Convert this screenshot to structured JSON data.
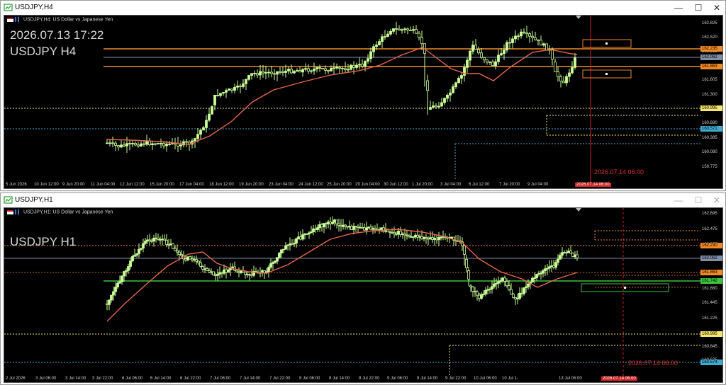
{
  "windows": [
    {
      "title": "USDJPY,H4",
      "header": "USDJPY,H4: US Dollar vs Japanese Yen",
      "big_lines": [
        "2026.07.13 17:22",
        "USDJPY H4"
      ],
      "price_scale": [
        "162.825",
        "162.520",
        "162.215",
        "161.605",
        "161.300",
        "160.995",
        "160.690",
        "160.385",
        "160.080",
        "159.775"
      ],
      "price_tags": [
        {
          "text": "162.235",
          "bg": "#f08a24",
          "fg": "#000000"
        },
        {
          "text": "162.062",
          "bg": "#7f8fa6",
          "fg": "#000000"
        },
        {
          "text": "161.863",
          "bg": "#f08a24",
          "fg": "#000000"
        },
        {
          "text": "160.995",
          "bg": "#f6e66a",
          "fg": "#000000"
        },
        {
          "text": "160.571",
          "bg": "#3fa9cf",
          "fg": "#000000"
        }
      ],
      "time_axis": [
        "5 Jun 2026",
        "10 Jun 12:00",
        "9 Jun 20:00",
        "11 Jun 04:00",
        "12 Jun 12:00",
        "15 Jun 20:00",
        "17 Jun 04:00",
        "18 Jun 12:00",
        "19 Jun 20:00",
        "23 Jun 04:00",
        "24 Jun 12:00",
        "25 Jun 20:00",
        "29 Jun 04:00",
        "30 Jun 12:00",
        "1 Jul 20:00",
        "3 Jul 04:00",
        "6 Jul 12:00",
        "7 Jul 20:00",
        "9 Jul 04:00"
      ],
      "time_now": "2026.07.14 06:00",
      "vline_label": "2026.07.14 06:00"
    },
    {
      "title": "USDJPY,H1",
      "header": "USDJPY,H1: US Dollar vs Japanese Yen",
      "big_lines": [
        "USDJPY H1"
      ],
      "price_scale": [
        "162.695",
        "162.475",
        "162.255",
        "161.660",
        "161.445",
        "161.225",
        "160.845",
        "160.635"
      ],
      "price_tags": [
        {
          "text": "162.230",
          "bg": "#f08a24",
          "fg": "#000000"
        },
        {
          "text": "162.062",
          "bg": "#7f8fa6",
          "fg": "#000000"
        },
        {
          "text": "161.863",
          "bg": "#f08a24",
          "fg": "#000000"
        },
        {
          "text": "161.742",
          "bg": "#3cc23c",
          "fg": "#000000"
        },
        {
          "text": "160.995",
          "bg": "#f6e66a",
          "fg": "#000000"
        },
        {
          "text": "160.574",
          "bg": "#3fa9cf",
          "fg": "#000000"
        }
      ],
      "time_axis": [
        "2 Jul 2026",
        "3 Jul 06:00",
        "3 Jul 14:00",
        "3 Jul 22:00",
        "6 Jul 06:00",
        "6 Jul 14:00",
        "6 Jul 22:00",
        "7 Jul 06:00",
        "7 Jul 14:00",
        "7 Jul 22:00",
        "8 Jul 06:00",
        "8 Jul 14:00",
        "8 Jul 22:00",
        "9 Jul 06:00",
        "9 Jul 14:00",
        "9 Jul 22:00",
        "10 Jul 06:00",
        "10 Jul 1-",
        "13 Jul 06:00"
      ],
      "time_now": "2026.07.14 06:00",
      "vline_label": "2026.07.14 06:00"
    }
  ],
  "colors": {
    "bg": "#000000",
    "candle": "#ccff99",
    "ma": "#e8684a",
    "orange_line": "#f08a24",
    "green_line": "#3cc23c",
    "yellow_dot": "#f6e66a",
    "cyan_dot": "#3fa9cf",
    "vline": "#d42020"
  },
  "icons": [
    "app-chart-icon",
    "minimize-icon",
    "maximize-icon",
    "close-icon"
  ]
}
